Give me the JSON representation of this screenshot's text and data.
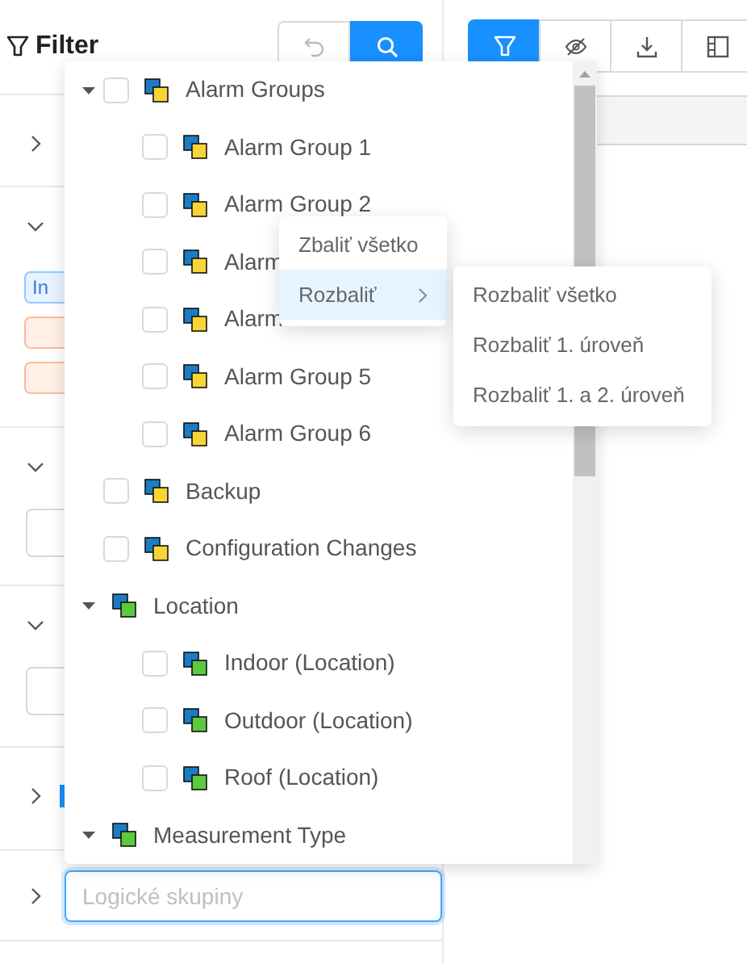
{
  "filter_panel": {
    "title": "Filter",
    "sections": [
      {
        "kind": "empty",
        "expanded": false
      },
      {
        "kind": "tags",
        "expanded": true,
        "tags": [
          {
            "label": "In",
            "color": "#91caff"
          },
          {
            "color": "#ffbb96"
          },
          {
            "color": "#ffbb96"
          }
        ]
      },
      {
        "kind": "field",
        "expanded": true
      },
      {
        "kind": "field",
        "expanded": true
      },
      {
        "kind": "marker",
        "expanded": false
      },
      {
        "kind": "search",
        "expanded": false,
        "placeholder": "Logické skupiny",
        "focused": true
      }
    ]
  },
  "toolbar": [
    {
      "kind": "filter",
      "selected": true
    },
    {
      "kind": "hide",
      "selected": false
    },
    {
      "kind": "download",
      "selected": false
    },
    {
      "kind": "columns",
      "selected": false
    }
  ],
  "tree": [
    {
      "label": "Alarm Groups",
      "kind": "check",
      "checked": false,
      "expanded": true,
      "color": "#f7d535",
      "children": [
        {
          "label": "Alarm Group 1",
          "kind": "check",
          "checked": false,
          "color": "#f7d535"
        },
        {
          "label": "Alarm Group 2",
          "kind": "check",
          "checked": false,
          "color": "#f7d535"
        },
        {
          "label": "Alarm",
          "kind": "check",
          "checked": false,
          "color": "#f7d535"
        },
        {
          "label": "Alarm",
          "kind": "check",
          "checked": false,
          "color": "#f7d535"
        },
        {
          "label": "Alarm Group 5",
          "kind": "check",
          "checked": false,
          "color": "#f7d535"
        },
        {
          "label": "Alarm Group 6",
          "kind": "check",
          "checked": false,
          "color": "#f7d535"
        }
      ]
    },
    {
      "label": "Backup",
      "kind": "check",
      "checked": false,
      "color": "#f7d535"
    },
    {
      "label": "Configuration Changes",
      "kind": "check",
      "checked": false,
      "color": "#f7d535"
    },
    {
      "label": "Location",
      "kind": "group",
      "expanded": true,
      "color": "#5cc93e",
      "children": [
        {
          "label": "Indoor (Location)",
          "kind": "check",
          "checked": false,
          "color": "#5cc93e"
        },
        {
          "label": "Outdoor (Location)",
          "kind": "check",
          "checked": false,
          "color": "#5cc93e"
        },
        {
          "label": "Roof (Location)",
          "kind": "check",
          "checked": false,
          "color": "#5cc93e"
        }
      ]
    },
    {
      "label": "Measurement Type",
      "kind": "group",
      "expanded": true,
      "color": "#5cc93e"
    }
  ],
  "context_menu": [
    {
      "label": "Zbaliť všetko",
      "active": false,
      "submenu": false
    },
    {
      "label": "Rozbaliť",
      "active": true,
      "submenu": true
    }
  ],
  "submenu": [
    {
      "label": "Rozbaliť všetko"
    },
    {
      "label": "Rozbaliť 1. úroveň"
    },
    {
      "label": "Rozbaliť 1. a 2. úroveň"
    }
  ]
}
